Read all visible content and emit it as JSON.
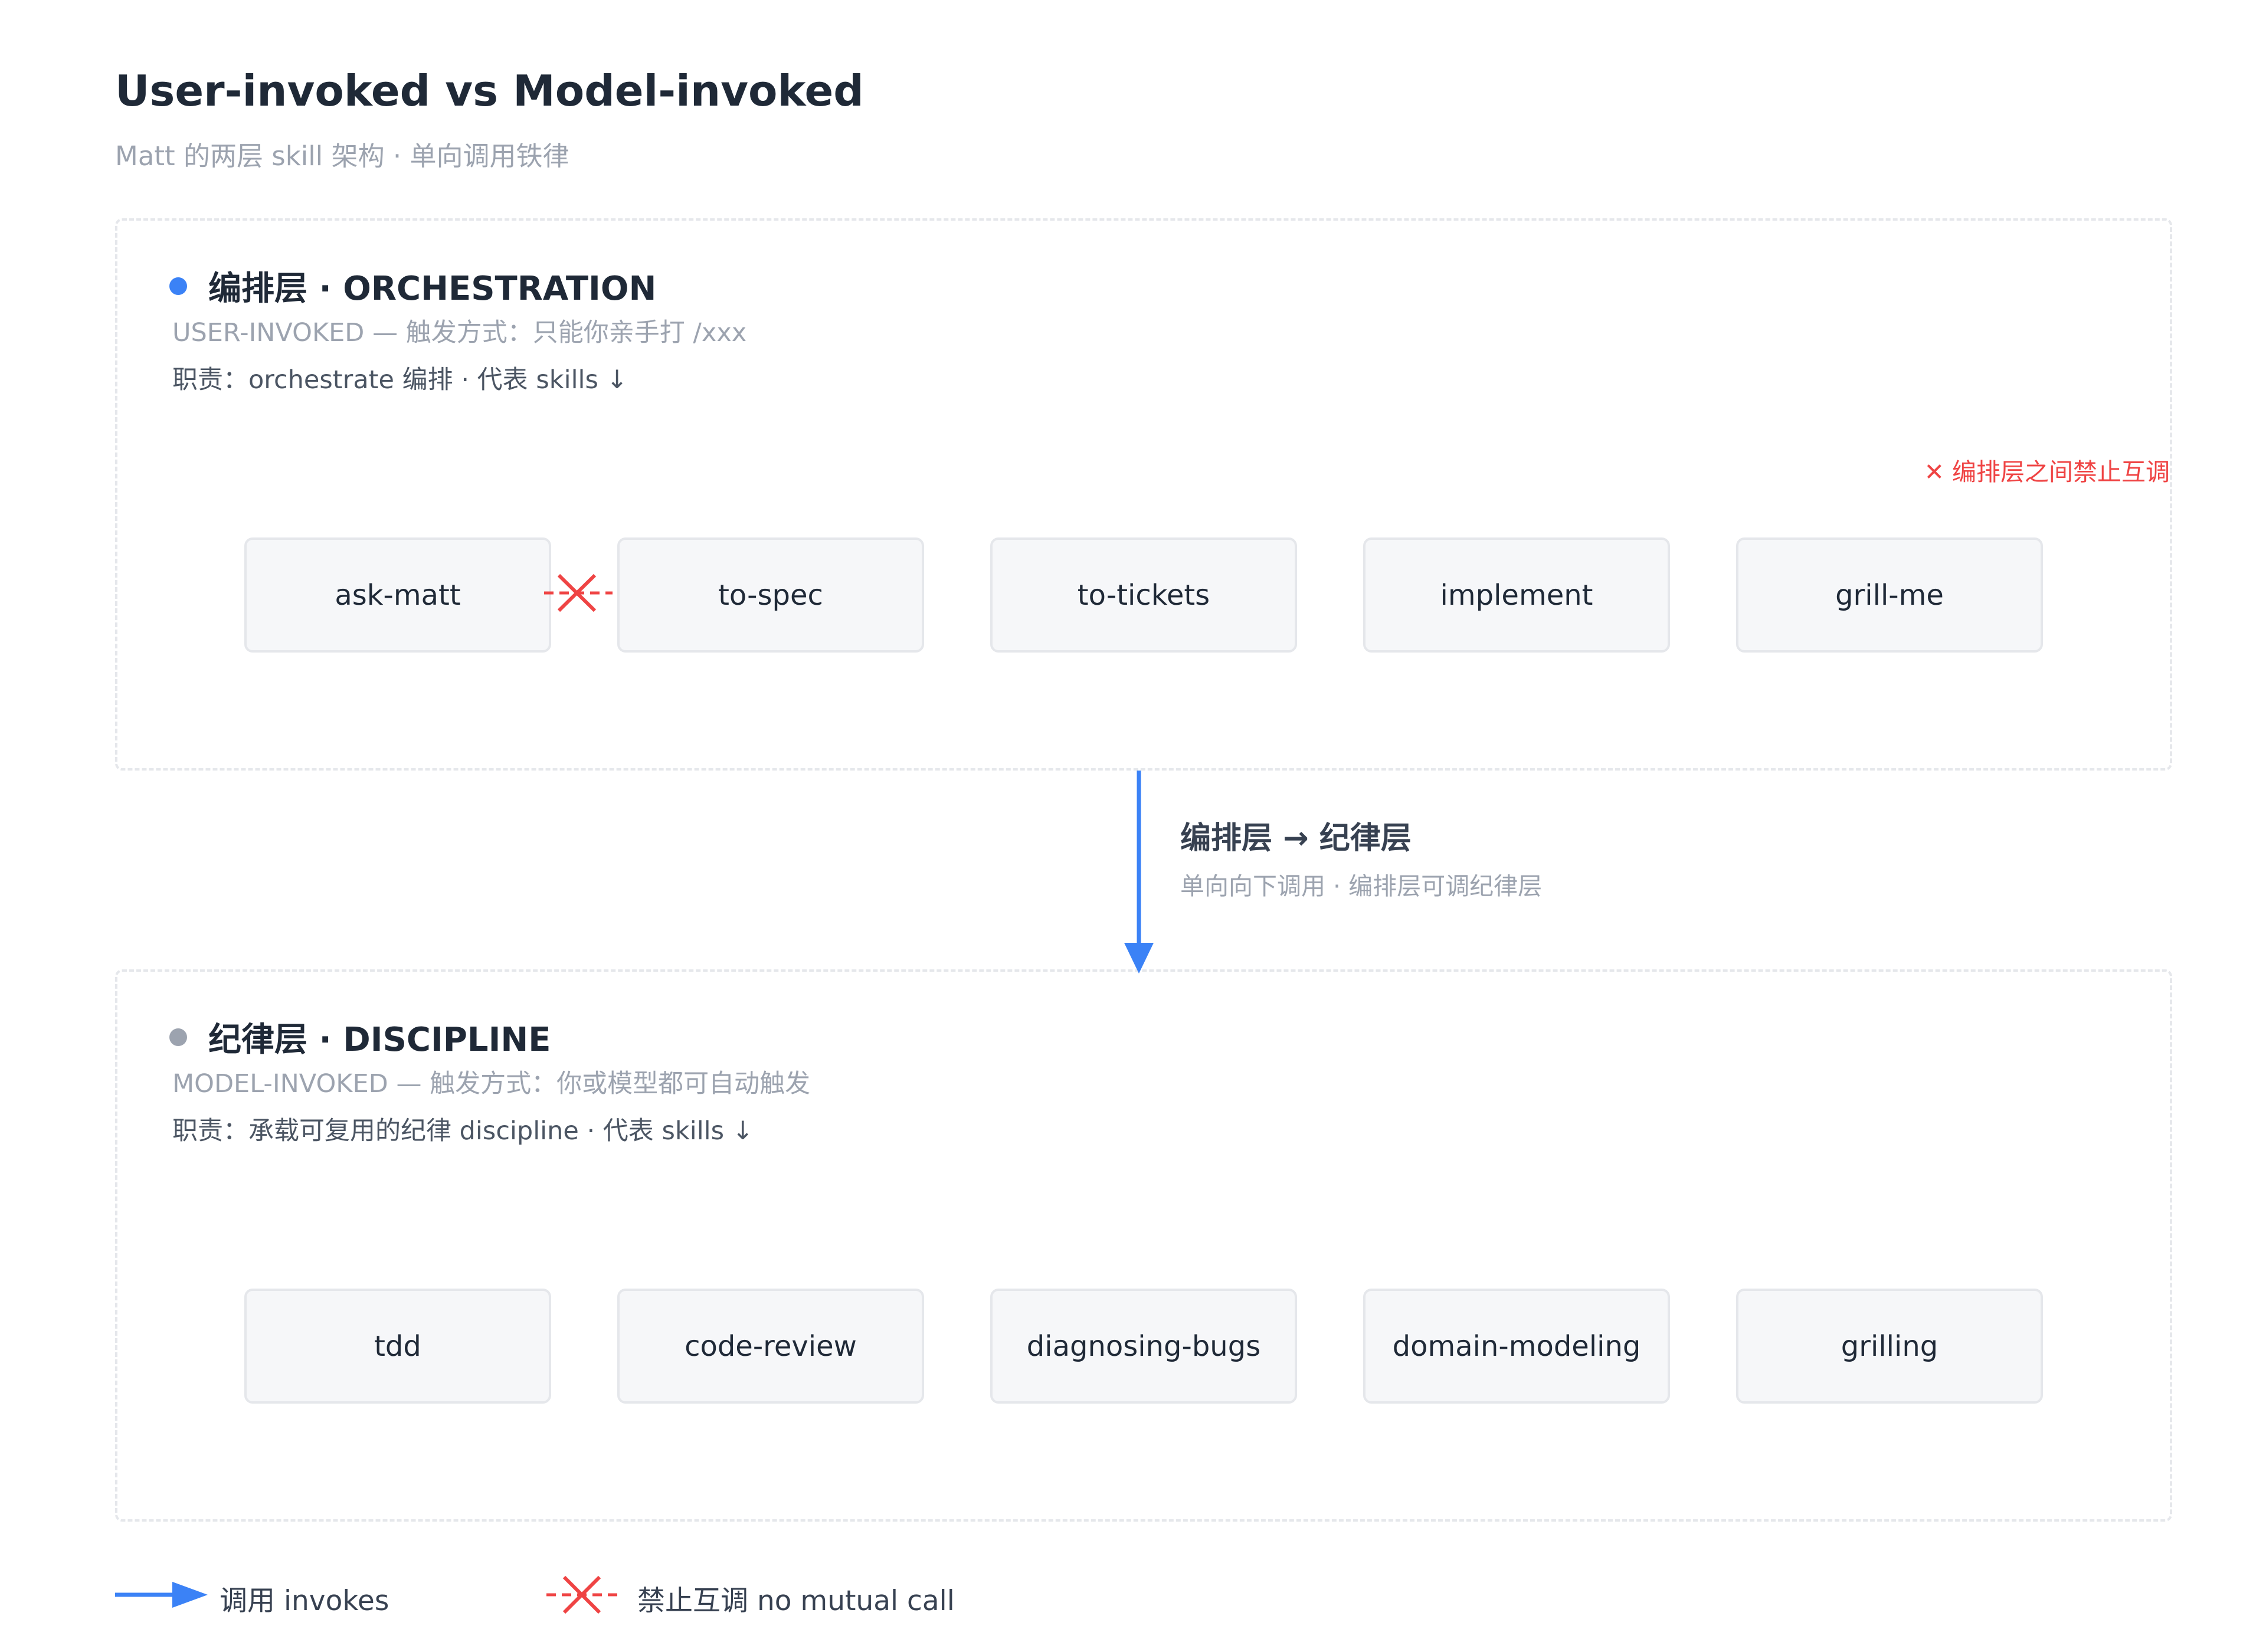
{
  "header": {
    "title": "User-invoked vs Model-invoked",
    "subtitle": "Matt 的两层 skill 架构 · 单向调用铁律"
  },
  "orchestration": {
    "title": "编排层 · ORCHESTRATION",
    "trigger": "USER-INVOKED — 触发方式：只能你亲手打 /xxx",
    "duty": "职责：orchestrate 编排 · 代表 skills ↓",
    "forbid_note": "✕ 编排层之间禁止互调",
    "skills": [
      "ask-matt",
      "to-spec",
      "to-tickets",
      "implement",
      "grill-me"
    ],
    "accent": "#3b82f6"
  },
  "flow": {
    "label": "编排层 → 纪律层",
    "sub": "单向向下调用 · 编排层可调纪律层"
  },
  "discipline": {
    "title": "纪律层 · DISCIPLINE",
    "trigger": "MODEL-INVOKED — 触发方式：你或模型都可自动触发",
    "duty": "职责：承载可复用的纪律 discipline · 代表 skills ↓",
    "skills": [
      "tdd",
      "code-review",
      "diagnosing-bugs",
      "domain-modeling",
      "grilling"
    ],
    "accent": "#9ca3af"
  },
  "legend": {
    "invokes": "调用 invokes",
    "no_mutual": "禁止互调 no mutual call"
  },
  "colors": {
    "invoke_arrow": "#3b82f6",
    "forbid": "#ef4444"
  }
}
